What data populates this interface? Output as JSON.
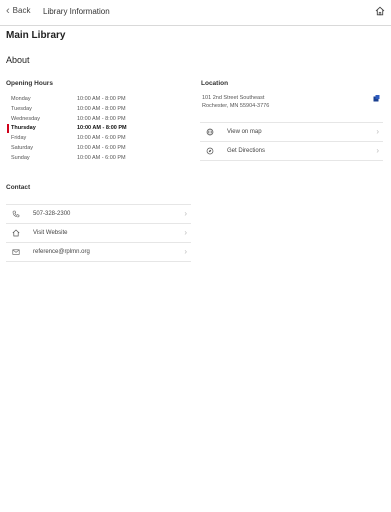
{
  "nav": {
    "back_label": "Back",
    "title": "Library Information"
  },
  "page": {
    "title": "Main Library",
    "about": "About"
  },
  "hours": {
    "title": "Opening Hours",
    "rows": [
      {
        "day": "Monday",
        "time": "10:00 AM - 8:00 PM"
      },
      {
        "day": "Tuesday",
        "time": "10:00 AM - 8:00 PM"
      },
      {
        "day": "Wednesday",
        "time": "10:00 AM - 8:00 PM"
      },
      {
        "day": "Thursday",
        "time": "10:00 AM - 8:00 PM"
      },
      {
        "day": "Friday",
        "time": "10:00 AM - 6:00 PM"
      },
      {
        "day": "Saturday",
        "time": "10:00 AM - 6:00 PM"
      },
      {
        "day": "Sunday",
        "time": "10:00 AM - 6:00 PM"
      }
    ],
    "today": "Thursday"
  },
  "location": {
    "title": "Location",
    "address_line1": "101 2nd Street Southeast",
    "address_line2": "Rochester, MN 55904-3776",
    "actions": [
      {
        "label": "View on map",
        "icon": "globe-icon"
      },
      {
        "label": "Get Directions",
        "icon": "compass-icon"
      }
    ]
  },
  "contact": {
    "title": "Contact",
    "items": [
      {
        "label": "507-328-2300",
        "icon": "phone-icon"
      },
      {
        "label": "Visit Website",
        "icon": "home-icon"
      },
      {
        "label": "reference@rplmn.org",
        "icon": "mail-icon"
      }
    ]
  },
  "colors": {
    "today_marker": "#d0021b",
    "map_pin": "#1a3f8f"
  }
}
